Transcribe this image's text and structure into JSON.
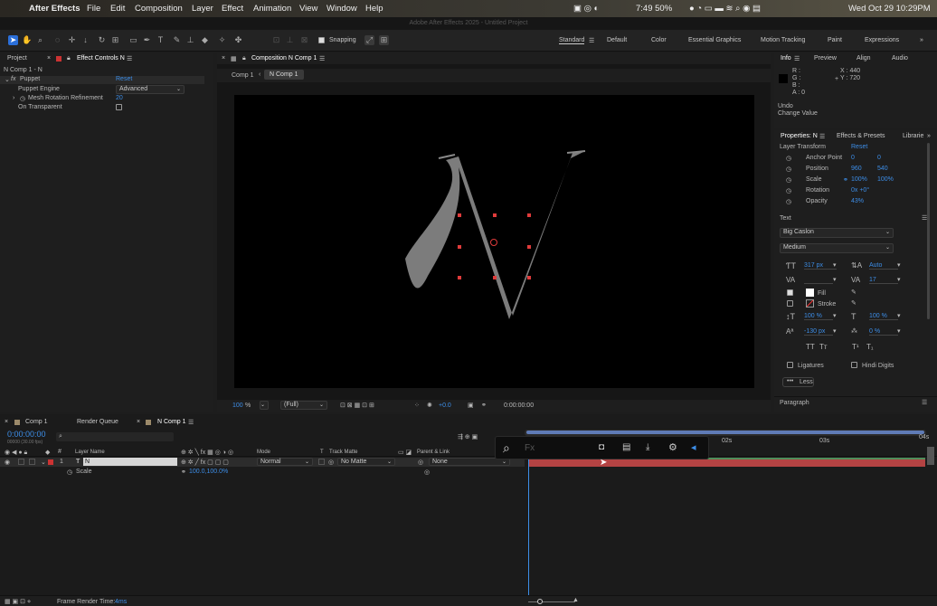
{
  "menubar": {
    "app": "After Effects",
    "items": [
      "File",
      "Edit",
      "Composition",
      "Layer",
      "Effect",
      "Animation",
      "View",
      "Window",
      "Help"
    ],
    "battery_text": "7:49 50%",
    "datetime": "Wed Oct 29  10:29PM"
  },
  "window_title": "Adobe After Effects 2025 - Untitled Project",
  "toolbar": {
    "snapping": "Snapping",
    "workspaces": [
      "Standard",
      "Default",
      "Color",
      "Essential Graphics",
      "Motion Tracking",
      "Paint",
      "Expressions"
    ]
  },
  "left_panel": {
    "tabs": [
      "Project",
      "Effect Controls N"
    ],
    "breadcrumb": "N Comp 1 - N",
    "effect_name": "Puppet",
    "reset": "Reset",
    "rows": [
      {
        "label": "Puppet Engine",
        "value": "Advanced"
      },
      {
        "label": "Mesh Rotation Refinement",
        "value": "20"
      },
      {
        "label": "On Transparent",
        "value": ""
      }
    ]
  },
  "comp_panel": {
    "tab": "Composition N Comp 1",
    "crumbs": [
      "Comp 1",
      "N Comp 1"
    ],
    "glyph": "N",
    "zoom": "100",
    "zoom_unit": "%",
    "resolution": "(Full)",
    "exposure": "+0.0",
    "timecode": "0:00:00:00"
  },
  "info_panel": {
    "tabs": [
      "Info",
      "Preview",
      "Align",
      "Audio"
    ],
    "rgba": [
      "R :",
      "G :",
      "B :",
      "A : 0"
    ],
    "x": "X : 440",
    "y": "Y : 720",
    "undo": "Undo",
    "undo_action": "Change Value"
  },
  "properties": {
    "tabs": [
      "Properties: N",
      "Effects & Presets",
      "Librarie"
    ],
    "section": "Layer Transform",
    "reset": "Reset",
    "rows": [
      {
        "label": "Anchor Point",
        "v1": "0",
        "v2": "0"
      },
      {
        "label": "Position",
        "v1": "960",
        "v2": "540"
      },
      {
        "label": "Scale",
        "v1": "100%",
        "v2": "100%"
      },
      {
        "label": "Rotation",
        "v1": "0x +0°",
        "v2": ""
      },
      {
        "label": "Opacity",
        "v1": "43%",
        "v2": ""
      }
    ],
    "text_section": "Text",
    "font": "Big Caslon",
    "style": "Medium",
    "font_size": "317 px",
    "leading": "Auto",
    "kerning": "",
    "tracking": "17",
    "fill": "Fill",
    "stroke": "Stroke",
    "vscale": "100 %",
    "hscale": "100 %",
    "baseline": "-130 px",
    "tsume": "0 %",
    "ligatures": "Ligatures",
    "hindi": "Hindi Digits",
    "less": "Less",
    "paragraph": "Paragraph"
  },
  "timeline": {
    "tabs": [
      "Comp 1",
      "Render Queue",
      "N Comp 1"
    ],
    "timecode": "0:00:00:00",
    "fps": "00000 (30.00 fps)",
    "search_placeholder": "",
    "headers": {
      "layer_name": "Layer Name",
      "mode": "Mode",
      "t": "T",
      "track_matte": "Track Matte",
      "parent": "Parent & Link"
    },
    "layer": {
      "num": "1",
      "name": "N",
      "mode": "Normal",
      "matte": "No Matte",
      "parent": "None"
    },
    "scale_prop": {
      "label": "Scale",
      "value": "100.0,100.0%"
    },
    "ruler": [
      "02s",
      "03s",
      "04s"
    ],
    "footer_label": "Frame Render Time:",
    "footer_value": "4ms"
  },
  "overlay": {
    "placeholder": "Fx"
  },
  "colors": {
    "accent": "#2b6fd9",
    "blue_value": "#3d8ee8",
    "handle": "#e03b3b",
    "track_red": "#b44343",
    "track_green": "#4f8f5a"
  }
}
